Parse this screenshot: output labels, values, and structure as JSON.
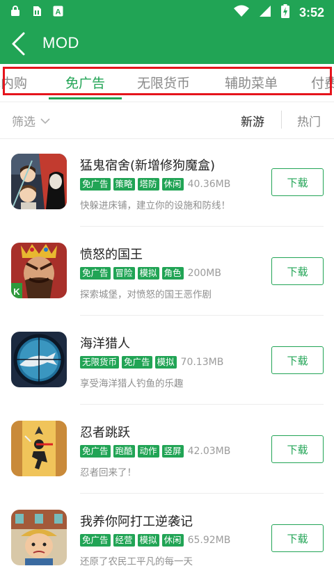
{
  "status_bar": {
    "time": "3:52",
    "icons": [
      "lock-icon",
      "sim-card-icon",
      "a-notification-icon",
      "wifi-icon",
      "signal-icon",
      "battery-charging-icon"
    ]
  },
  "header": {
    "title": "MOD",
    "back_icon": "back-arrow-icon"
  },
  "tabs": [
    {
      "label": "无内购",
      "active": false
    },
    {
      "label": "免广告",
      "active": true
    },
    {
      "label": "无限货币",
      "active": false
    },
    {
      "label": "辅助菜单",
      "active": false
    },
    {
      "label": "付费",
      "active": false
    }
  ],
  "filter": {
    "label": "筛选",
    "sort_new": "新游",
    "sort_hot": "热门"
  },
  "colors": {
    "primary": "#21a455",
    "highlight_box": "#e5141c"
  },
  "apps": [
    {
      "name": "猛鬼宿舍(新增修狗魔盒)",
      "tags": [
        "免广告",
        "策略",
        "塔防",
        "休闲"
      ],
      "size": "40.36MB",
      "desc": "快躲进床铺，建立你的设施和防线！",
      "button": "下载",
      "icon": "ghost-dorm-game-icon"
    },
    {
      "name": "愤怒的国王",
      "tags": [
        "免广告",
        "冒险",
        "模拟",
        "角色"
      ],
      "size": "200MB",
      "desc": "探索城堡，对愤怒的国王恶作剧",
      "button": "下载",
      "icon": "angry-king-game-icon"
    },
    {
      "name": "海洋猎人",
      "tags": [
        "无限货币",
        "免广告",
        "模拟"
      ],
      "size": "70.13MB",
      "desc": "享受海洋猎人钓鱼的乐趣",
      "button": "下载",
      "icon": "ocean-hunter-game-icon"
    },
    {
      "name": "忍者跳跃",
      "tags": [
        "免广告",
        "跑酷",
        "动作",
        "竖屏"
      ],
      "size": "42.03MB",
      "desc": "忍者回来了！",
      "button": "下载",
      "icon": "ninja-jump-game-icon"
    },
    {
      "name": "我养你阿打工逆袭记",
      "tags": [
        "免广告",
        "经营",
        "模拟",
        "休闲"
      ],
      "size": "65.92MB",
      "desc": "还原了农民工平凡的每一天",
      "button": "下载",
      "icon": "worker-comeback-game-icon"
    }
  ]
}
